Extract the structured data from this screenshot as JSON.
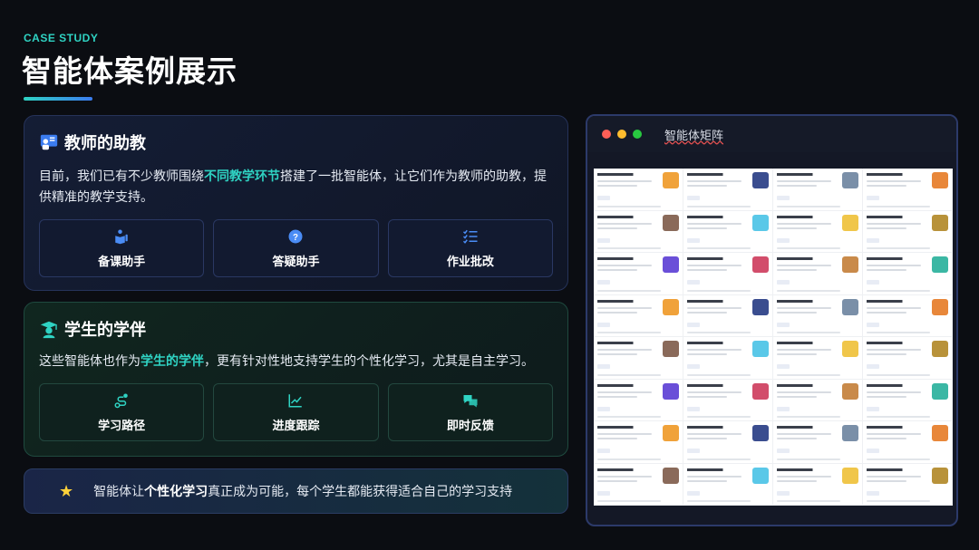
{
  "header": {
    "label": "CASE STUDY",
    "title": "智能体案例展示"
  },
  "teacher_card": {
    "title": "教师的助教",
    "desc_before": "目前，我们已有不少教师围绕",
    "desc_highlight": "不同教学环节",
    "desc_after": "搭建了一批智能体，让它们作为教师的助教，提供精准的教学支持。",
    "features": [
      {
        "label": "备课助手",
        "icon": "book-reader-icon"
      },
      {
        "label": "答疑助手",
        "icon": "question-circle-icon"
      },
      {
        "label": "作业批改",
        "icon": "checklist-icon"
      }
    ]
  },
  "student_card": {
    "title": "学生的学伴",
    "desc_before": "这些智能体也作为",
    "desc_highlight": "学生的学伴",
    "desc_after": "，更有针对性地支持学生的个性化学习，尤其是自主学习。",
    "features": [
      {
        "label": "学习路径",
        "icon": "route-icon"
      },
      {
        "label": "进度跟踪",
        "icon": "line-chart-icon"
      },
      {
        "label": "即时反馈",
        "icon": "chat-bubbles-icon"
      }
    ]
  },
  "banner": {
    "before": "智能体让",
    "highlight": "个性化学习",
    "after": "真正成为可能，每个学生都能获得适合自己的学习支持"
  },
  "window": {
    "title": "智能体矩阵"
  },
  "colors": {
    "accent": "#2fd3c3",
    "blue": "#3b7cf0",
    "star": "#ffd23a",
    "dot_red": "#ff5f57",
    "dot_yellow": "#febc2e",
    "dot_green": "#28c840"
  }
}
